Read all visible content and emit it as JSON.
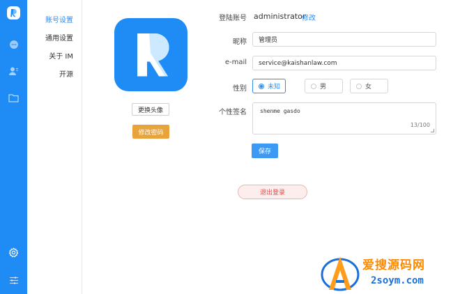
{
  "rail": {
    "logo_icon": "app-logo-icon",
    "icons": [
      "chat-icon",
      "contacts-icon",
      "folder-icon",
      "settings-gear-icon",
      "sliders-icon"
    ],
    "active_icon": "settings-gear-icon",
    "background": "#1f8cf5"
  },
  "submenu": {
    "items": [
      {
        "label": "账号设置",
        "active": true
      },
      {
        "label": "通用设置",
        "active": false
      },
      {
        "label": "关于 IM",
        "active": false
      },
      {
        "label": "开源",
        "active": false
      }
    ]
  },
  "profile": {
    "avatar_icon": "app-logo-icon",
    "change_avatar_label": "更换头像",
    "change_password_label": "修改密码"
  },
  "form": {
    "account_label": "登陆账号",
    "account_value": "administrator",
    "account_edit_label": "修改",
    "nickname_label": "昵称",
    "nickname_value": "管理员",
    "email_label": "e-mail",
    "email_value": "service@kaishanlaw.com",
    "gender_label": "性别",
    "gender_options": [
      {
        "label": "未知",
        "checked": true
      },
      {
        "label": "男",
        "checked": false
      },
      {
        "label": "女",
        "checked": false
      }
    ],
    "signature_label": "个性签名",
    "signature_value": "shenme gasdo",
    "signature_count": "13/100",
    "save_label": "保存",
    "logout_label": "退出登录"
  },
  "watermark": {
    "line1": "爱搜源码网",
    "line2": "2soym.com"
  },
  "colors": {
    "accent": "#2f8cf0",
    "orange_button": "#e8a33a",
    "logout_text": "#e24c4c"
  }
}
